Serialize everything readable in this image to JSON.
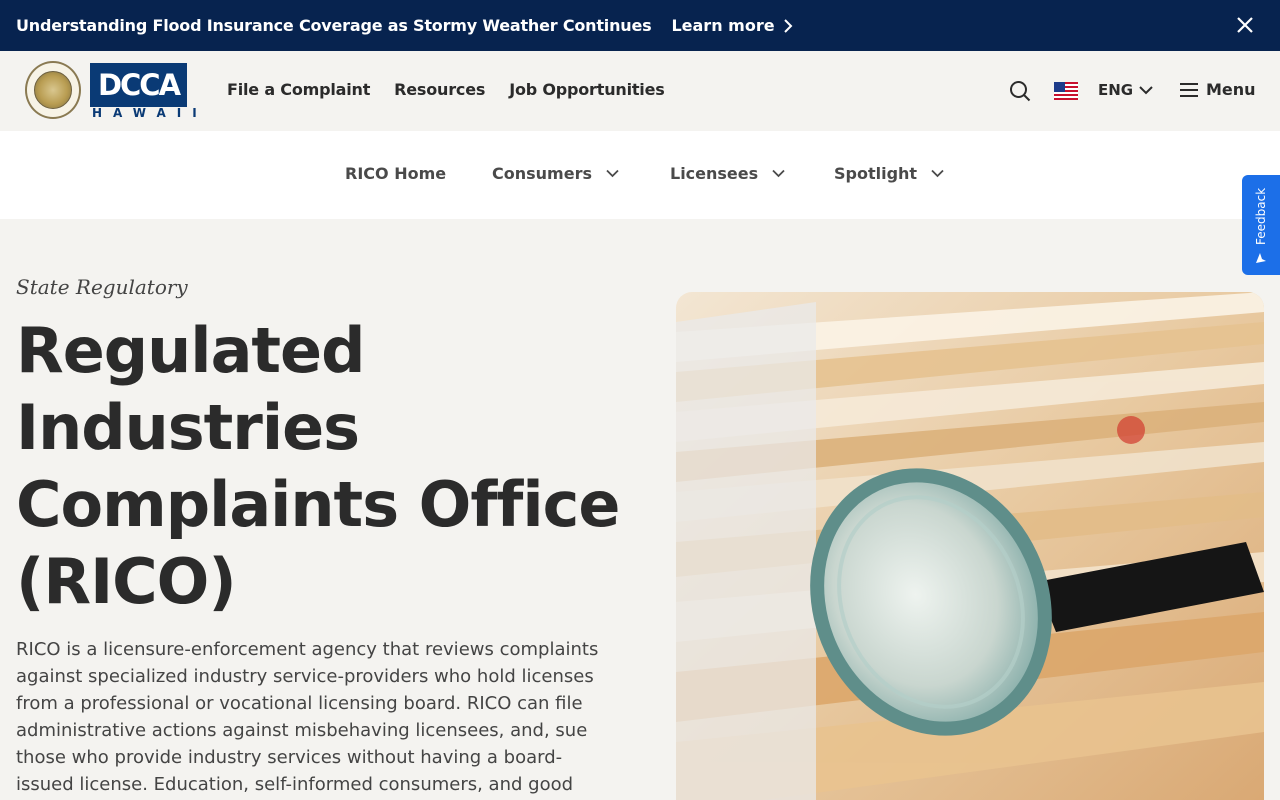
{
  "alert": {
    "text": "Understanding Flood Insurance Coverage as Stormy Weather Continues",
    "link_label": "Learn more"
  },
  "header": {
    "logo_text": "DCCA",
    "logo_sub": "HAWAII",
    "nav": [
      "File a Complaint",
      "Resources",
      "Job Opportunities"
    ],
    "language": "ENG",
    "menu_label": "Menu"
  },
  "subnav": {
    "items": [
      {
        "label": "RICO Home"
      },
      {
        "label": "Consumers"
      },
      {
        "label": "Licensees"
      },
      {
        "label": "Spotlight"
      }
    ]
  },
  "feedback": {
    "label": "Feedback"
  },
  "hero": {
    "eyebrow": "State Regulatory",
    "title": "Regulated Industries Complaints Office (RICO)",
    "description": "RICO is a licensure-enforcement agency that reviews complaints against specialized industry service-providers who hold licenses from a professional or vocational licensing board. RICO can file administrative actions against misbehaving licensees, and, sue those who provide industry services without having a board-issued license. Education, self-informed consumers, and good"
  },
  "colors": {
    "banner": "#07234f",
    "brand": "#0a3a75",
    "feedback": "#1c6fe8",
    "page_bg": "#f4f3f0"
  },
  "icons": [
    "chevron-right-icon",
    "close-icon",
    "search-icon",
    "us-flag-icon",
    "chevron-down-icon",
    "hamburger-icon",
    "feedback-icon"
  ]
}
